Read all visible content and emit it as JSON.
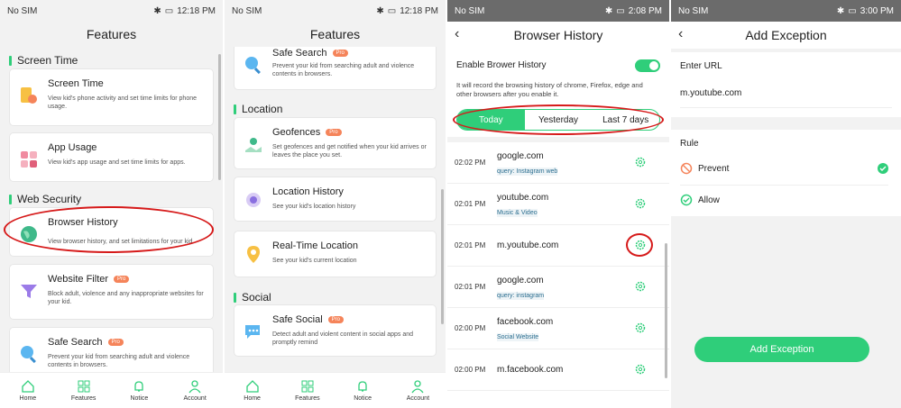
{
  "status": {
    "carrier": "No SIM",
    "time1": "12:18 PM",
    "time3": "2:08 PM",
    "time4": "3:00 PM"
  },
  "p1": {
    "title": "Features",
    "sec_screen": "Screen Time",
    "screen_time": {
      "title": "Screen Time",
      "desc": "View kid's phone activity and set time limits for phone usage."
    },
    "app_usage": {
      "title": "App Usage",
      "desc": "View kid's app usage and set time limits for apps."
    },
    "sec_web": "Web Security",
    "browser_history": {
      "title": "Browser History",
      "desc": "View browser history, and set limitations for your kid"
    },
    "website_filter": {
      "title": "Website Filter",
      "desc": "Block adult, violence and any inappropriate websites for your kid."
    },
    "safe_search": {
      "title": "Safe Search",
      "desc": "Prevent your kid from searching adult and violence contents in browsers."
    },
    "pro": "Pro"
  },
  "p2": {
    "title": "Features",
    "safe_search": {
      "title": "Safe Search",
      "desc": "Prevent your kid from searching adult and violence contents in browsers."
    },
    "sec_location": "Location",
    "geofences": {
      "title": "Geofences",
      "desc": "Set geofences and get notified when your kid arrives or leaves the place you set."
    },
    "location_history": {
      "title": "Location History",
      "desc": "See your kid's location history"
    },
    "realtime": {
      "title": "Real-Time Location",
      "desc": "See your kid's current location"
    },
    "sec_social": "Social",
    "safe_social": {
      "title": "Safe Social",
      "desc": "Detect adult and violent content in social apps and promptly remind"
    }
  },
  "tabs": [
    "Home",
    "Features",
    "Notice",
    "Account"
  ],
  "p3": {
    "title": "Browser History",
    "enable": "Enable Brower History",
    "note": "It will record the browsing history of chrome, Firefox, edge and other browsers after you enable it.",
    "segments": [
      "Today",
      "Yesterday",
      "Last 7 days"
    ],
    "rows": [
      {
        "time": "02:02 PM",
        "domain": "google.com",
        "cat": "query: Instagram web"
      },
      {
        "time": "02:01 PM",
        "domain": "youtube.com",
        "cat": "Music & Video"
      },
      {
        "time": "02:01 PM",
        "domain": "m.youtube.com",
        "cat": ""
      },
      {
        "time": "02:01 PM",
        "domain": "google.com",
        "cat": "query: instagram"
      },
      {
        "time": "02:00 PM",
        "domain": "facebook.com",
        "cat": "Social Website"
      },
      {
        "time": "02:00 PM",
        "domain": "m.facebook.com",
        "cat": ""
      }
    ]
  },
  "p4": {
    "title": "Add Exception",
    "enter_url": "Enter URL",
    "url": "m.youtube.com",
    "rule": "Rule",
    "prevent": "Prevent",
    "allow": "Allow",
    "button": "Add Exception"
  },
  "colors": {
    "accent": "#2fce7a",
    "pro": "#f5845a",
    "highlight": "#d61a1a"
  }
}
